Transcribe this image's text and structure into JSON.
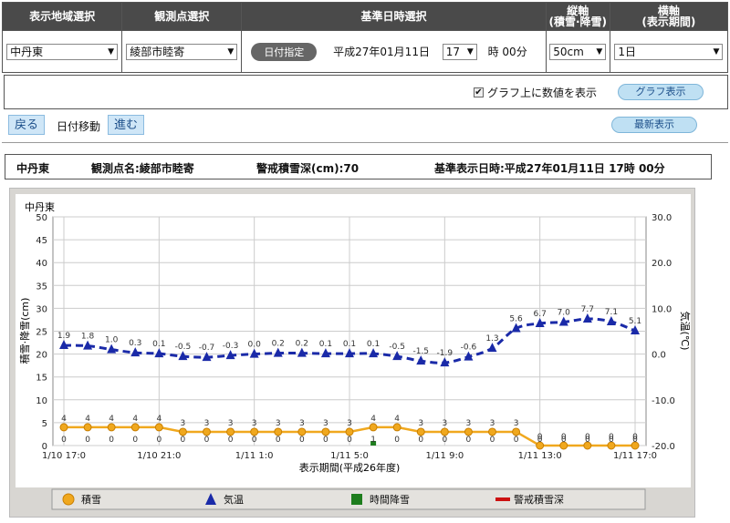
{
  "header": {
    "region_label": "表示地域選択",
    "station_label": "観測点選択",
    "datetime_label": "基準日時選択",
    "yaxis_label_l1": "縦軸",
    "yaxis_label_l2": "(積雪·降雪)",
    "xaxis_label_l1": "横軸",
    "xaxis_label_l2": "(表示期間)"
  },
  "controls": {
    "region_value": "中丹東",
    "station_value": "綾部市睦寄",
    "date_button": "日付指定",
    "date_text": "平成27年01月11日",
    "hour_value": "17",
    "hour_suffix": "時 00分",
    "yaxis_value": "50cm",
    "xaxis_value": "1日"
  },
  "options": {
    "show_values_label": "グラフ上に数値を表示",
    "show_values_checked": true,
    "graph_button": "グラフ表示"
  },
  "nav": {
    "back": "戻る",
    "move_label": "日付移動",
    "forward": "進む",
    "latest_button": "最新表示"
  },
  "info": {
    "region": "中丹東",
    "station": "観測点名:綾部市睦寄",
    "warning_depth": "警戒積雪深(cm):70",
    "base_datetime": "基準表示日時:平成27年01月11日 17時 00分"
  },
  "chart_data": {
    "type": "line",
    "station_title": "中丹東",
    "left_ylabel": "積雪·降雪(cm)",
    "right_ylabel": "気温(℃)",
    "xlabel": "表示期間(平成26年度)",
    "left_ylim": [
      0,
      50
    ],
    "left_ticks": [
      "0",
      "5",
      "10",
      "15",
      "20",
      "25",
      "30",
      "35",
      "40",
      "45",
      "50"
    ],
    "right_ylim": [
      -20,
      30
    ],
    "right_ticks": [
      "-20.0",
      "-10.0",
      "0.0",
      "10.0",
      "20.0",
      "30.0"
    ],
    "x_tick_labels": [
      "1/10 17:0",
      "1/10 21:0",
      "1/11 1:0",
      "1/11 5:0",
      "1/11 9:0",
      "1/11 13:0",
      "1/11 17:0"
    ],
    "x_hours": [
      0,
      1,
      2,
      3,
      4,
      5,
      6,
      7,
      8,
      9,
      10,
      11,
      12,
      13,
      14,
      15,
      16,
      17,
      18,
      19,
      20,
      21,
      22,
      23,
      24
    ],
    "series": [
      {
        "name": "積雪",
        "color": "#f0a81e",
        "values": [
          4,
          4,
          4,
          4,
          4,
          3,
          3,
          3,
          3,
          3,
          3,
          3,
          3,
          4,
          4,
          3,
          3,
          3,
          3,
          3,
          0,
          0,
          0,
          0,
          0
        ],
        "labels": [
          "4",
          "4",
          "4",
          "4",
          "4",
          "3",
          "3",
          "3",
          "3",
          "3",
          "3",
          "3",
          "3",
          "4",
          "4",
          "3",
          "3",
          "3",
          "3",
          "3",
          "0",
          "0",
          "0",
          "0",
          "0"
        ]
      },
      {
        "name": "気温",
        "color": "#1a2aa8",
        "values": [
          1.9,
          1.8,
          1.0,
          0.3,
          0.1,
          -0.5,
          -0.7,
          -0.3,
          0.0,
          0.2,
          0.2,
          0.1,
          0.1,
          0.1,
          -0.5,
          -1.5,
          -1.9,
          -0.6,
          1.3,
          5.6,
          6.7,
          7.0,
          7.7,
          7.1,
          5.1
        ],
        "labels": [
          "1.9",
          "1.8",
          "1.0",
          "0.3",
          "0.1",
          "-0.5",
          "-0.7",
          "-0.3",
          "0.0",
          "0.2",
          "0.2",
          "0.1",
          "0.1",
          "0.1",
          "-0.5",
          "-1.5",
          "-1.9",
          "-0.6",
          "1.3",
          "5.6",
          "6.7",
          "7.0",
          "7.7",
          "7.1",
          "5.1"
        ]
      },
      {
        "name": "時間降雪",
        "color": "#1e7d1e",
        "values": [
          0,
          0,
          0,
          0,
          0,
          0,
          0,
          0,
          0,
          0,
          0,
          0,
          0,
          1,
          0,
          0,
          0,
          0,
          0,
          0,
          0,
          0,
          0,
          0,
          0
        ],
        "labels": [
          "0",
          "0",
          "0",
          "0",
          "0",
          "0",
          "0",
          "0",
          "0",
          "0",
          "0",
          "0",
          "0",
          "1",
          "0",
          "0",
          "0",
          "0",
          "0",
          "0",
          "0",
          "0",
          "0",
          "0",
          "0"
        ]
      },
      {
        "name": "警戒積雪深",
        "color": "#cc1111",
        "value": 70
      }
    ],
    "legend_position": "bottom",
    "grid": true
  }
}
